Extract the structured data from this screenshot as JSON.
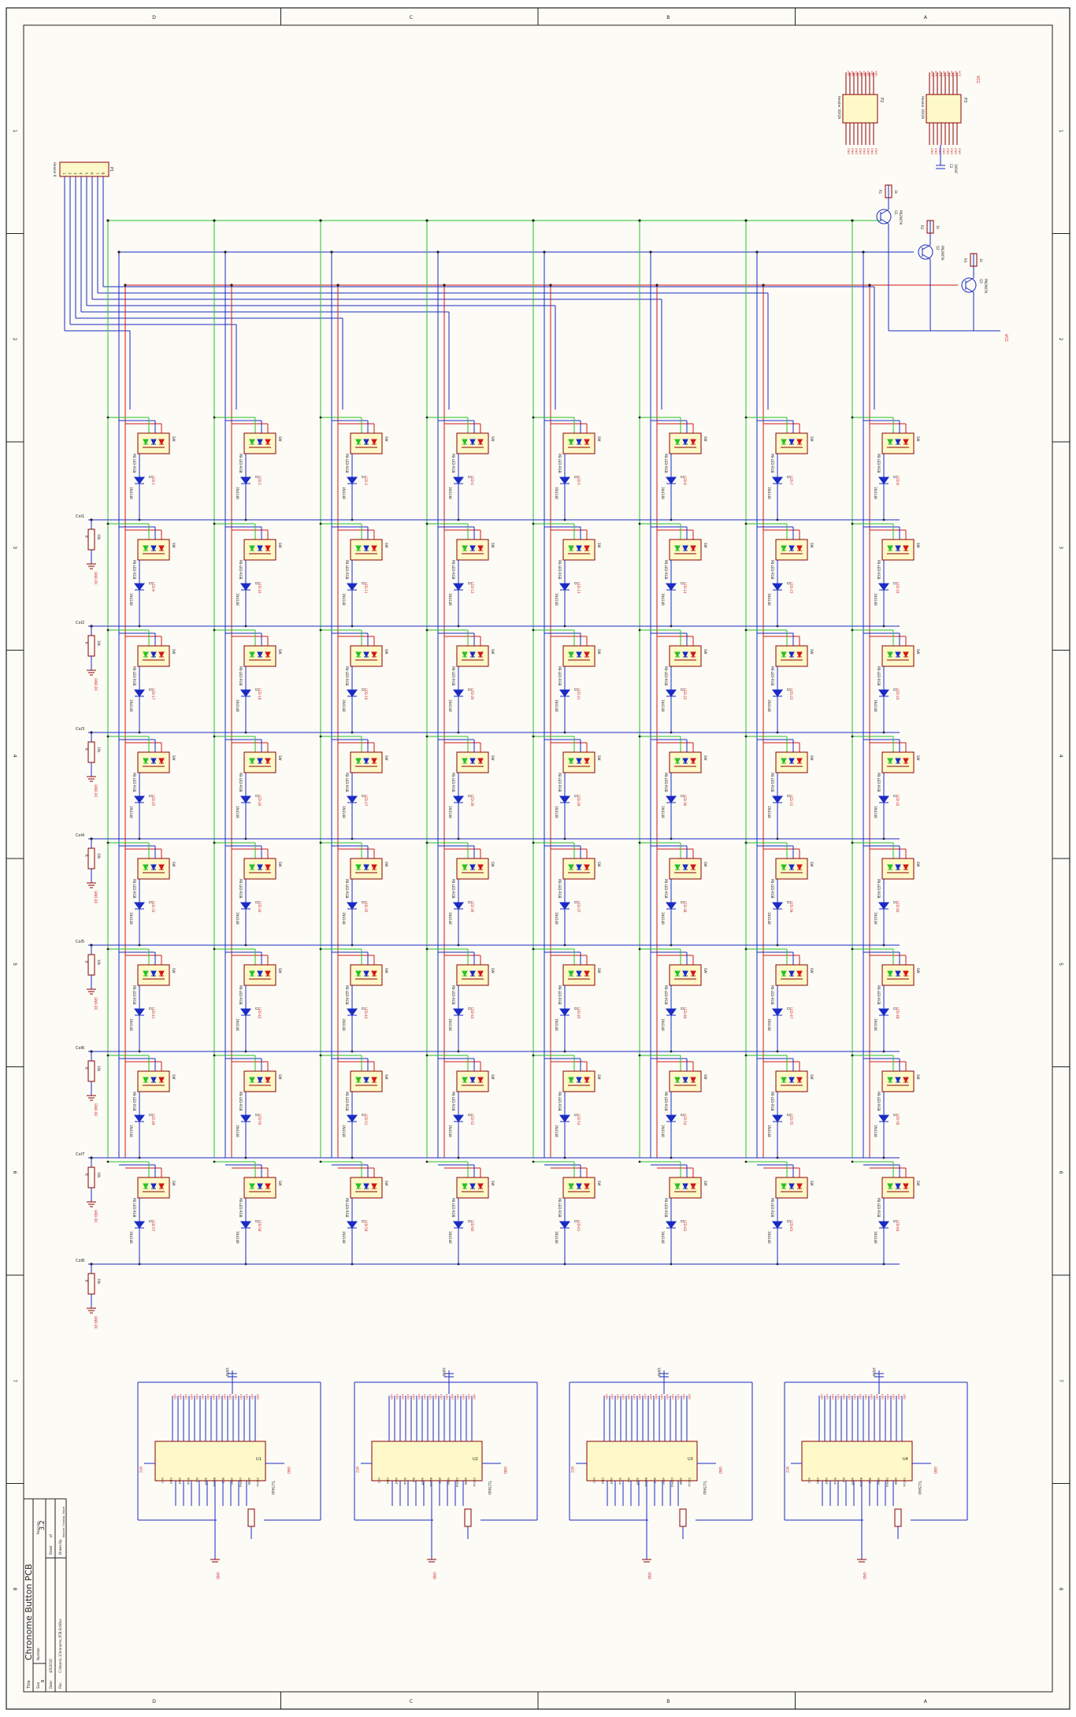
{
  "sheet": {
    "title": "Chronome Button PCB",
    "version": "3.2",
    "number": "1",
    "zone_cols": [
      "D",
      "C",
      "B",
      "A"
    ],
    "zone_rows": [
      "1",
      "2",
      "3",
      "4",
      "5",
      "6",
      "7",
      "8"
    ]
  },
  "title_block": {
    "title_label": "Title",
    "size_label": "Size",
    "size_value": "B",
    "number_label": "Number",
    "date_label": "Date:",
    "file_label": "File:",
    "sheet_label": "Sheet",
    "drawn_label": "Drawn By:",
    "revision_label": "Revision",
    "date_value": "4/5/2010",
    "file_value": "C:\\Users\\..\\Chronome_PCB.SchDoc",
    "sheet_value": "of",
    "author": "Kestrel / Shasta, Valve"
  },
  "header_connector": {
    "ref": "P1",
    "name": "Header 8",
    "pins": [
      "1",
      "2",
      "3",
      "4",
      "5",
      "6",
      "7",
      "8"
    ]
  },
  "top_right": {
    "p2_ref": "P2",
    "p2_name": "Header 16X2A",
    "p3_ref": "P3",
    "p3_name": "Header 16X2A",
    "vcc": "VCC",
    "gnd": "GND",
    "cap_ref": "C2",
    "cap_value": "100nF",
    "q_refs": [
      "Q1",
      "Q2",
      "Q3"
    ],
    "q_part": "PN2907A",
    "r_refs": [
      "R1",
      "R2",
      "R3"
    ],
    "r_value": "1k"
  },
  "matrix": {
    "sw_part": "PB-LED-RGB",
    "diode_part": "1N4148",
    "row_labels": [
      "Col1",
      "Col2",
      "Col3",
      "Col4",
      "Col5",
      "Col6",
      "Col7",
      "Col8"
    ],
    "row_resistor": "10k",
    "row_gnd": "GND-DC"
  },
  "drivers": [
    {
      "ref": "U1",
      "part": "TLC5940",
      "supply": "VCC",
      "gnd": "GND",
      "cap": "100nF",
      "pin_labels": [
        "VCC",
        "GND",
        "XLAT",
        "SCLK",
        "SIN",
        "SOUT",
        "BLANK",
        "IREF",
        "VPRG",
        "DCPRG",
        "XERR",
        "GSCLK"
      ]
    },
    {
      "ref": "U2",
      "part": "TLC5940",
      "supply": "VCC",
      "gnd": "GND",
      "cap": "100nF",
      "pin_labels": [
        "VCC",
        "GND",
        "XLAT",
        "SCLK",
        "SIN",
        "SOUT",
        "BLANK",
        "IREF",
        "VPRG",
        "DCPRG",
        "XERR",
        "GSCLK"
      ]
    },
    {
      "ref": "U3",
      "part": "TLC5940",
      "supply": "VCC",
      "gnd": "GND",
      "cap": "100nF",
      "pin_labels": [
        "VCC",
        "GND",
        "XLAT",
        "SCLK",
        "SIN",
        "SOUT",
        "BLANK",
        "IREF",
        "VPRG",
        "DCPRG",
        "XERR",
        "GSCLK"
      ]
    },
    {
      "ref": "U4",
      "part": "TLC5940",
      "supply": "VCC",
      "gnd": "GND",
      "cap": "100nF",
      "pin_labels": [
        "VCC",
        "GND",
        "XLAT",
        "SCLK",
        "SIN",
        "SOUT",
        "BLANK",
        "IREF",
        "VPRG",
        "DCPRG",
        "XERR",
        "GSCLK"
      ]
    }
  ],
  "colors": {
    "paper": "#fcfbf6",
    "frame": "#222222",
    "wire": "#1a2bc4",
    "net_red": "#d01818",
    "net_green": "#28c028",
    "component": "#8b0000",
    "body_fill": "#fff8c8"
  }
}
